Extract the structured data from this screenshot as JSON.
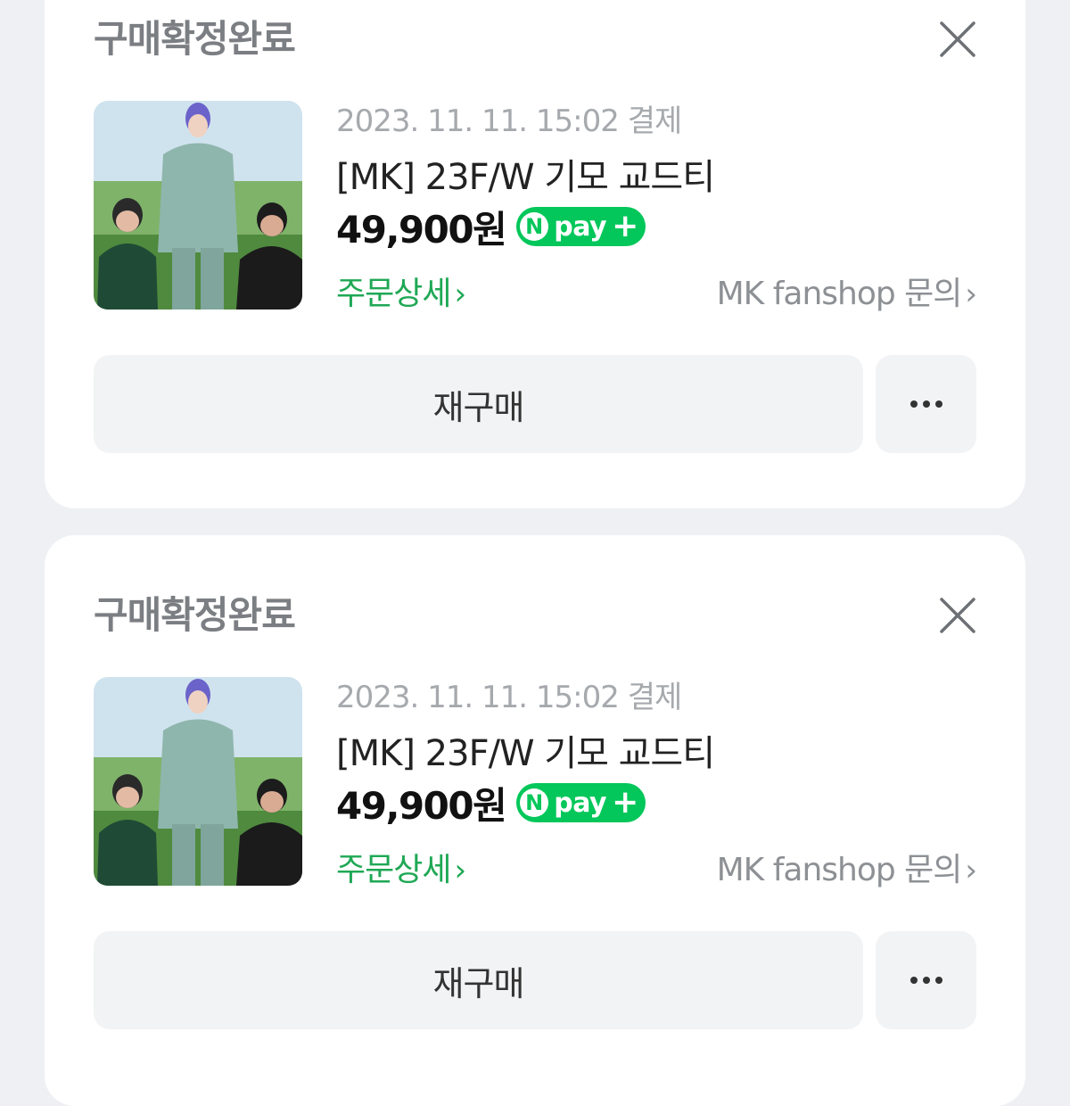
{
  "orders": [
    {
      "status": "구매확정완료",
      "date": "2023. 11. 11. 15:02 결제",
      "title": "[MK] 23F/W 기모 교드티",
      "price": "49,900원",
      "npay": {
        "n": "N",
        "pay": "pay",
        "plus": "+"
      },
      "detail_link": "주문상세",
      "seller_link": "MK fanshop 문의",
      "rebuy_label": "재구매",
      "chevron": "›"
    },
    {
      "status": "구매확정완료",
      "date": "2023. 11. 11. 15:02 결제",
      "title": "[MK] 23F/W 기모 교드티",
      "price": "49,900원",
      "npay": {
        "n": "N",
        "pay": "pay",
        "plus": "+"
      },
      "detail_link": "주문상세",
      "seller_link": "MK fanshop 문의",
      "rebuy_label": "재구매",
      "chevron": "›"
    }
  ],
  "colors": {
    "npay_green": "#03c75a",
    "detail_green": "#1fa855",
    "background": "#eef0f3"
  },
  "icons": [
    "close-icon",
    "more-icon",
    "chevron-right-icon",
    "npay-logo"
  ]
}
